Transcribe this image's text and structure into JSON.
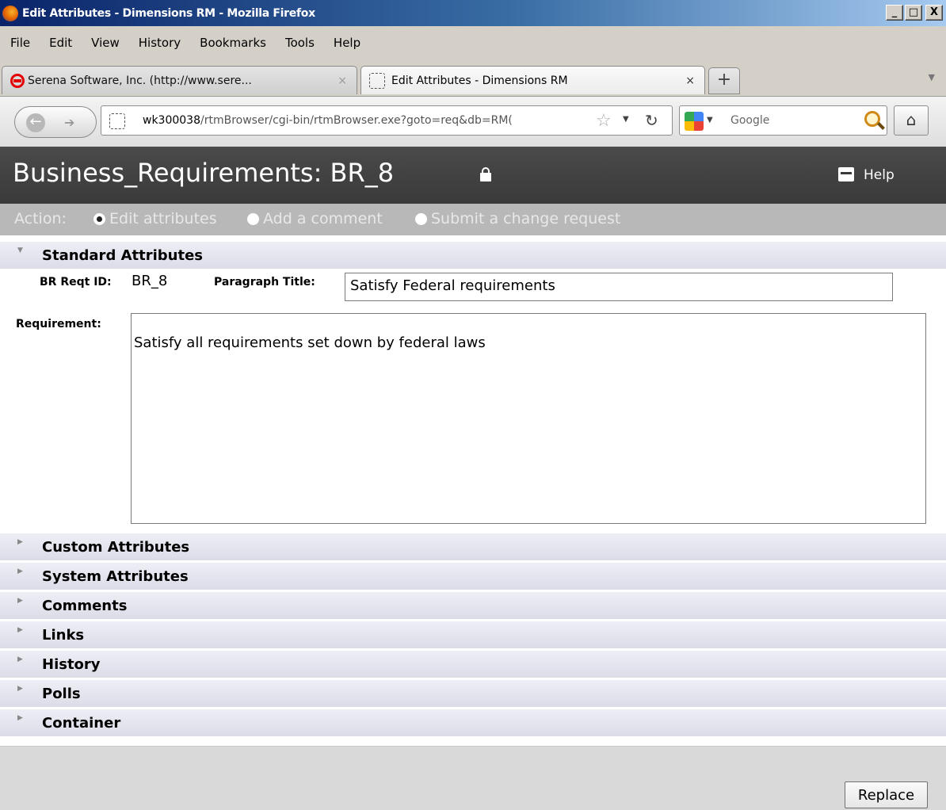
{
  "window": {
    "title": "Edit Attributes - Dimensions RM - Mozilla Firefox",
    "controls": [
      "_",
      "□",
      "X"
    ]
  },
  "menu": [
    "File",
    "Edit",
    "View",
    "History",
    "Bookmarks",
    "Tools",
    "Help"
  ],
  "tabs": [
    {
      "label": "Serena Software, Inc. (http://www.sere...",
      "close": "×"
    },
    {
      "label": "Edit Attributes - Dimensions RM",
      "close": "×"
    }
  ],
  "new_tab": "+",
  "nav": {
    "url_host": "wk300038",
    "url_path": "/rtmBrowser/cgi-bin/rtmBrowser.exe?goto=req&db=RM(",
    "search_placeholder": "Google"
  },
  "page": {
    "title": "Business_Requirements: BR_8",
    "help": "Help",
    "action_label": "Action:",
    "actions": [
      {
        "label": "Edit attributes",
        "selected": true
      },
      {
        "label": "Add a comment",
        "selected": false
      },
      {
        "label": "Submit a change request",
        "selected": false
      }
    ],
    "standard_section": "Standard Attributes",
    "reqt_id_label": "BR Reqt ID:",
    "reqt_id_value": "BR_8",
    "paragraph_title_label": "Paragraph Title:",
    "paragraph_title_value": "Satisfy Federal requirements",
    "requirement_label": "Requirement:",
    "requirement_value": "Satisfy all requirements set down by federal laws",
    "sections": [
      "Custom Attributes",
      "System Attributes",
      "Comments",
      "Links",
      "History",
      "Polls",
      "Container"
    ],
    "replace_button": "Replace"
  }
}
